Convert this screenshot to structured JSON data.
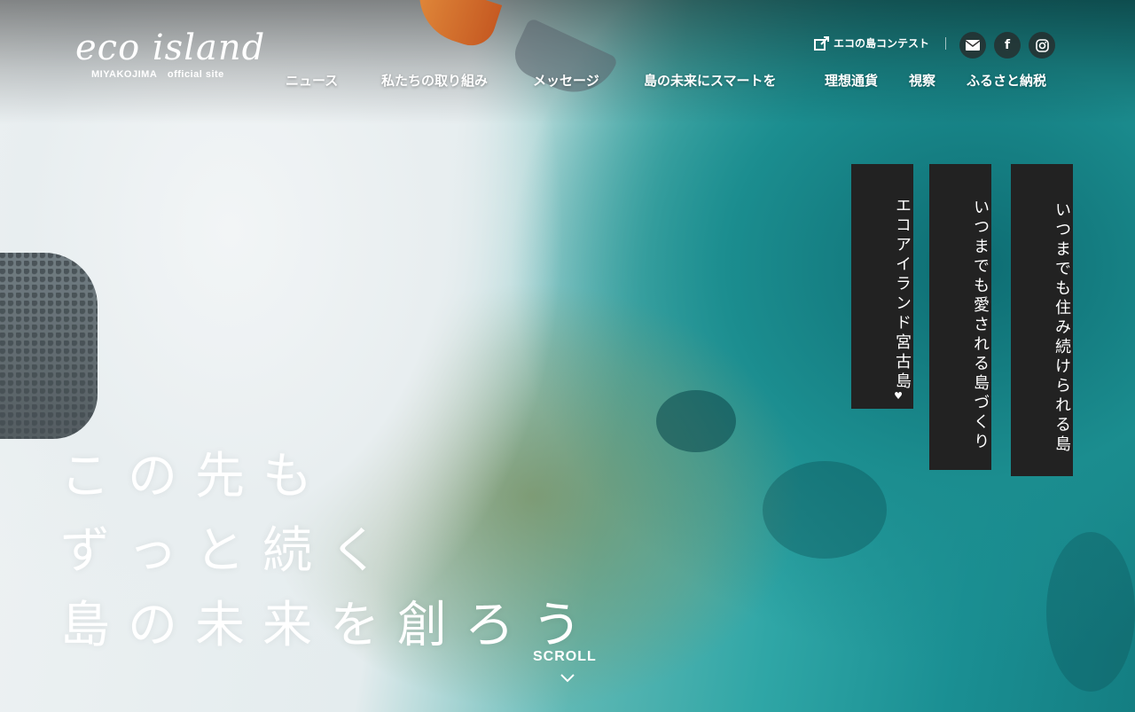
{
  "logo": {
    "main": "eco island",
    "sub_place": "MIYAKOJIMA",
    "sub_tag": "official site"
  },
  "nav": {
    "items": [
      "ニュース",
      "私たちの取り組み",
      "メッセージ",
      "島の未来にスマートを",
      "理想通貨",
      "視察",
      "ふるさと納税"
    ]
  },
  "header": {
    "contest_link": "エコの島コンテスト",
    "social_icons": [
      "mail-icon",
      "facebook-icon",
      "instagram-icon"
    ]
  },
  "vertical_tags": [
    "エコアイランド宮古島",
    "いつまでも愛される島づくり",
    "いつまでも住み続けられる島"
  ],
  "hero": {
    "line1": "この先も",
    "line2": "ずっと続く",
    "line3": "島の未来を創ろう"
  },
  "scroll_label": "SCROLL"
}
